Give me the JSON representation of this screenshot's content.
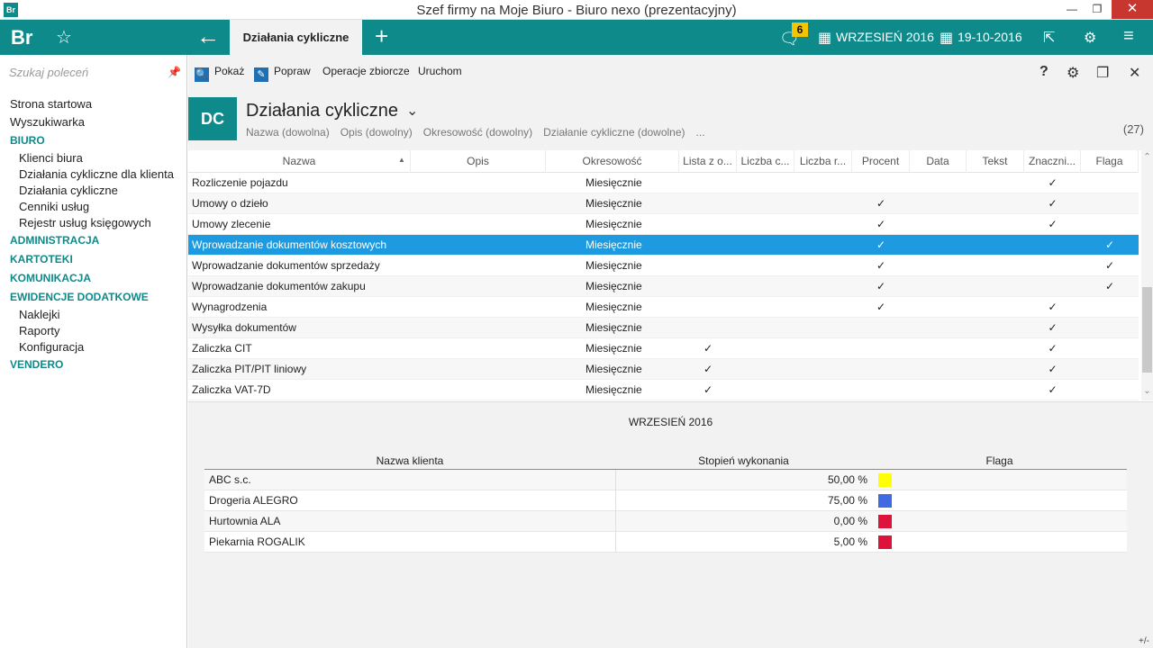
{
  "window": {
    "title": "Szef firmy na Moje Biuro - Biuro nexo (prezentacyjny)",
    "app_icon": "Br"
  },
  "header": {
    "logo": "Br",
    "active_tab": "Działania cykliczne",
    "notification_count": "6",
    "period": "WRZESIEŃ 2016",
    "date": "19-10-2016"
  },
  "sidebar": {
    "search_placeholder": "Szukaj poleceń",
    "items": [
      {
        "type": "item",
        "label": "Strona startowa"
      },
      {
        "type": "item",
        "label": "Wyszukiwarka"
      },
      {
        "type": "section",
        "label": "BIURO"
      },
      {
        "type": "sub",
        "label": "Klienci biura"
      },
      {
        "type": "sub",
        "label": "Działania cykliczne dla klienta"
      },
      {
        "type": "sub",
        "label": "Działania cykliczne"
      },
      {
        "type": "sub",
        "label": "Cenniki usług"
      },
      {
        "type": "sub",
        "label": "Rejestr usług księgowych"
      },
      {
        "type": "section",
        "label": "ADMINISTRACJA"
      },
      {
        "type": "section",
        "label": "KARTOTEKI"
      },
      {
        "type": "section",
        "label": "KOMUNIKACJA"
      },
      {
        "type": "section",
        "label": "EWIDENCJE DODATKOWE"
      },
      {
        "type": "sub",
        "label": "Naklejki"
      },
      {
        "type": "sub",
        "label": "Raporty"
      },
      {
        "type": "sub",
        "label": "Konfiguracja"
      },
      {
        "type": "section",
        "label": "VENDERO"
      }
    ]
  },
  "toolbar": {
    "show": "Pokaż",
    "edit": "Popraw",
    "bulk": "Operacje zbiorcze",
    "run": "Uruchom",
    "help": "?"
  },
  "page": {
    "badge": "DC",
    "title": "Działania cykliczne",
    "filters": [
      "Nazwa (dowolna)",
      "Opis (dowolny)",
      "Okresowość (dowolny)",
      "Działanie cykliczne (dowolne)",
      "..."
    ],
    "count": "(27)"
  },
  "grid": {
    "columns": [
      "Nazwa",
      "Opis",
      "Okresowość",
      "Lista z o...",
      "Liczba c...",
      "Liczba r...",
      "Procent",
      "Data",
      "Tekst",
      "Znaczni...",
      "Flaga"
    ],
    "check_symbol": "✓",
    "rows": [
      {
        "name": "Rozliczenie pojazdu",
        "period": "Miesięcznie",
        "lista": false,
        "procent": false,
        "znacznik": true,
        "flaga": false
      },
      {
        "name": "Umowy o dzieło",
        "period": "Miesięcznie",
        "lista": false,
        "procent": true,
        "znacznik": true,
        "flaga": false
      },
      {
        "name": "Umowy zlecenie",
        "period": "Miesięcznie",
        "lista": false,
        "procent": true,
        "znacznik": true,
        "flaga": false
      },
      {
        "name": "Wprowadzanie dokumentów kosztowych",
        "period": "Miesięcznie",
        "lista": false,
        "procent": true,
        "znacznik": false,
        "flaga": true,
        "selected": true
      },
      {
        "name": "Wprowadzanie dokumentów sprzedaży",
        "period": "Miesięcznie",
        "lista": false,
        "procent": true,
        "znacznik": false,
        "flaga": true
      },
      {
        "name": "Wprowadzanie dokumentów zakupu",
        "period": "Miesięcznie",
        "lista": false,
        "procent": true,
        "znacznik": false,
        "flaga": true
      },
      {
        "name": "Wynagrodzenia",
        "period": "Miesięcznie",
        "lista": false,
        "procent": true,
        "znacznik": true,
        "flaga": false
      },
      {
        "name": "Wysyłka dokumentów",
        "period": "Miesięcznie",
        "lista": false,
        "procent": false,
        "znacznik": true,
        "flaga": false
      },
      {
        "name": "Zaliczka CIT",
        "period": "Miesięcznie",
        "lista": true,
        "procent": false,
        "znacznik": true,
        "flaga": false
      },
      {
        "name": "Zaliczka PIT/PIT liniowy",
        "period": "Miesięcznie",
        "lista": true,
        "procent": false,
        "znacznik": true,
        "flaga": false
      },
      {
        "name": "Zaliczka VAT-7D",
        "period": "Miesięcznie",
        "lista": true,
        "procent": false,
        "znacznik": true,
        "flaga": false
      }
    ]
  },
  "detail": {
    "period": "WRZESIEŃ 2016",
    "columns": [
      "Nazwa klienta",
      "Stopień wykonania",
      "Flaga"
    ],
    "rows": [
      {
        "client": "ABC s.c.",
        "progress": "50,00 %",
        "flag_color": "#ffff00"
      },
      {
        "client": "Drogeria ALEGRO",
        "progress": "75,00 %",
        "flag_color": "#4169e1"
      },
      {
        "client": "Hurtownia ALA",
        "progress": "0,00 %",
        "flag_color": "#dc143c"
      },
      {
        "client": "Piekarnia ROGALIK",
        "progress": "5,00 %",
        "flag_color": "#dc143c"
      }
    ],
    "plusminus": "+/-"
  },
  "colors": {
    "accent": "#0e8a8a",
    "selection": "#1e9be0",
    "badge": "#f5c400"
  }
}
